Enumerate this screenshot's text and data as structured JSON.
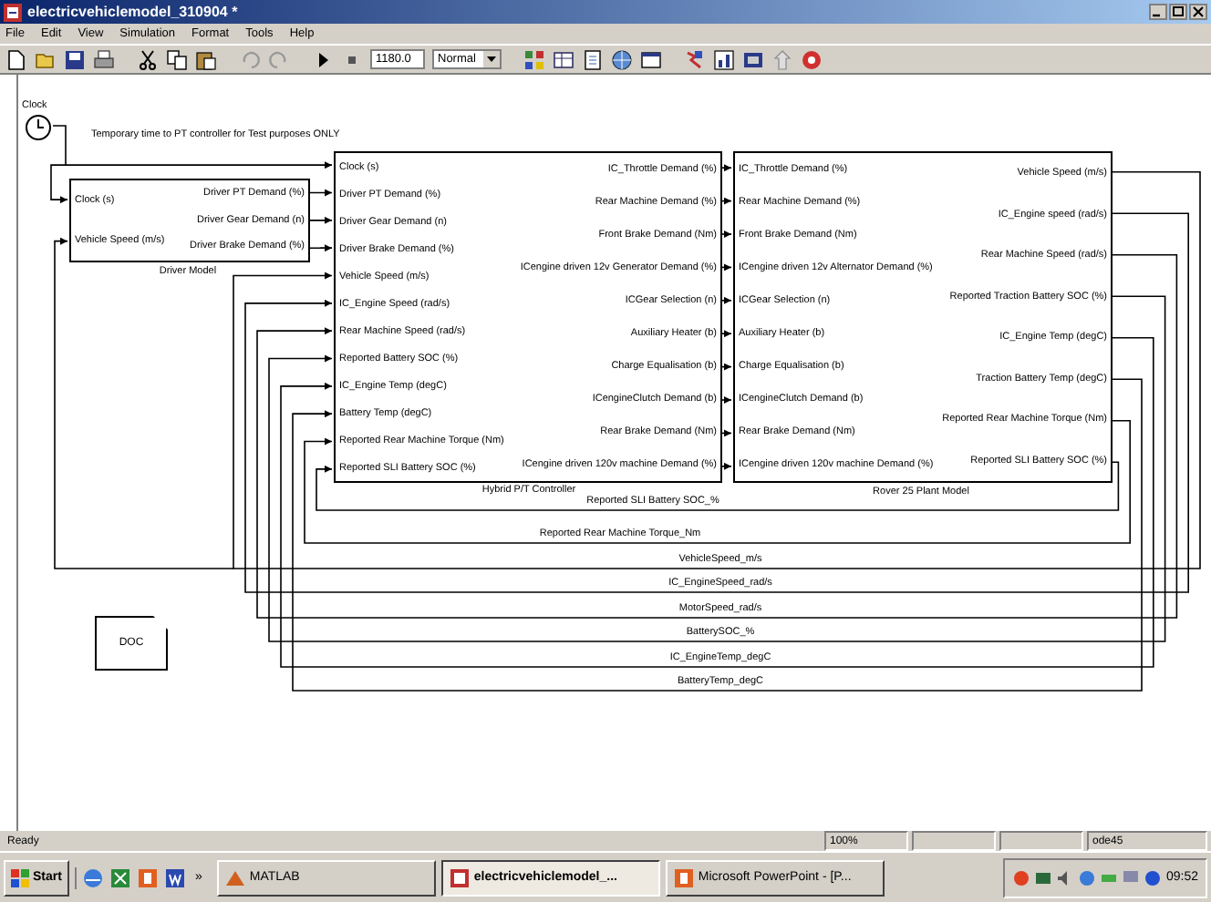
{
  "window": {
    "title": "electricvehiclemodel_310904 *"
  },
  "menu": [
    "File",
    "Edit",
    "View",
    "Simulation",
    "Format",
    "Tools",
    "Help"
  ],
  "toolbar": {
    "stop_time": "1180.0",
    "mode": "Normal"
  },
  "canvas": {
    "clock": {
      "label": "Clock"
    },
    "annotation": "Temporary time to PT controller for Test purposes ONLY",
    "blocks": [
      {
        "kind": "subsystem",
        "caption": "Driver Model",
        "inputs": [
          "Clock (s)",
          "Vehicle Speed (m/s)"
        ],
        "outputs": [
          "Driver PT Demand (%)",
          "Driver Gear Demand (n)",
          "Driver Brake Demand (%)"
        ]
      },
      {
        "kind": "subsystem",
        "caption": "Hybrid P/T Controller",
        "inputs": [
          "Clock (s)",
          "Driver PT Demand (%)",
          "Driver Gear Demand (n)",
          "Driver Brake Demand (%)",
          "Vehicle Speed (m/s)",
          "IC_Engine Speed (rad/s)",
          "Rear Machine Speed (rad/s)",
          "Reported Battery SOC (%)",
          "IC_Engine Temp (degC)",
          "Battery Temp (degC)",
          "Reported Rear Machine Torque (Nm)",
          "Reported SLI Battery SOC (%)"
        ],
        "outputs": [
          "IC_Throttle Demand (%)",
          "Rear Machine Demand (%)",
          "Front Brake Demand (Nm)",
          "ICengine driven 12v Generator Demand (%)",
          "ICGear Selection (n)",
          "Auxiliary Heater (b)",
          "Charge Equalisation (b)",
          "ICengineClutch Demand (b)",
          "Rear Brake Demand (Nm)",
          "ICengine driven 120v machine Demand (%)"
        ]
      },
      {
        "kind": "subsystem",
        "caption": "Rover 25 Plant Model",
        "inputs": [
          "IC_Throttle Demand (%)",
          "Rear Machine  Demand (%)",
          "Front Brake Demand (Nm)",
          "ICengine driven 12v Alternator Demand (%)",
          "ICGear Selection (n)",
          "Auxiliary Heater (b)",
          "Charge Equalisation (b)",
          "ICengineClutch Demand (b)",
          "Rear Brake Demand (Nm)",
          "ICengine driven 120v machine Demand (%)"
        ],
        "outputs": [
          "Vehicle Speed (m/s)",
          "IC_Engine speed (rad/s)",
          "Rear Machine Speed (rad/s)",
          "Reported Traction Battery SOC (%)",
          "IC_Engine Temp (degC)",
          "Traction Battery Temp (degC)",
          "Reported Rear Machine Torque (Nm)",
          "Reported SLI Battery SOC (%)"
        ]
      }
    ],
    "signal_labels": [
      "Reported SLI Battery SOC_%",
      "Reported Rear Machine Torque_Nm",
      "VehicleSpeed_m/s",
      "IC_EngineSpeed_rad/s",
      "MotorSpeed_rad/s",
      "BatterySOC_%",
      "IC_EngineTemp_degC",
      "BatteryTemp_degC"
    ],
    "doc_block": {
      "label": "DOC"
    }
  },
  "status_bar": {
    "message": "Ready",
    "zoom": "100%",
    "solver": "ode45"
  },
  "taskbar": {
    "start": "Start",
    "more": "»",
    "tasks": [
      {
        "label": "MATLAB",
        "selected": false
      },
      {
        "label": "electricvehiclemodel_...",
        "selected": true
      },
      {
        "label": "Microsoft PowerPoint - [P...",
        "selected": false
      }
    ],
    "clock": "09:52"
  }
}
